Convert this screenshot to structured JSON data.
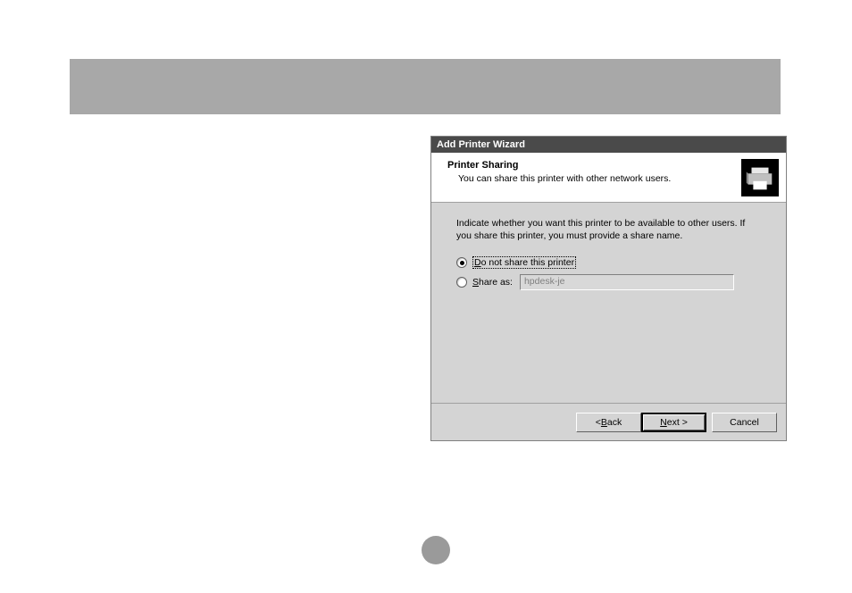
{
  "dialog": {
    "title": "Add Printer Wizard",
    "headerTitle": "Printer Sharing",
    "headerSubtitle": "You can share this printer with other network users.",
    "instruction": "Indicate whether you want this printer to be available to other users. If you share this printer, you must provide a share name.",
    "radio1_prefix": "D",
    "radio1_rest": "o not share this printer",
    "radio2_prefix": "S",
    "radio2_rest": "hare as:",
    "shareValue": "hpdesk-je",
    "backBtn_prefix": "< ",
    "backBtn_u": "B",
    "backBtn_rest": "ack",
    "nextBtn_u": "N",
    "nextBtn_rest": "ext >",
    "cancelBtn": "Cancel"
  }
}
